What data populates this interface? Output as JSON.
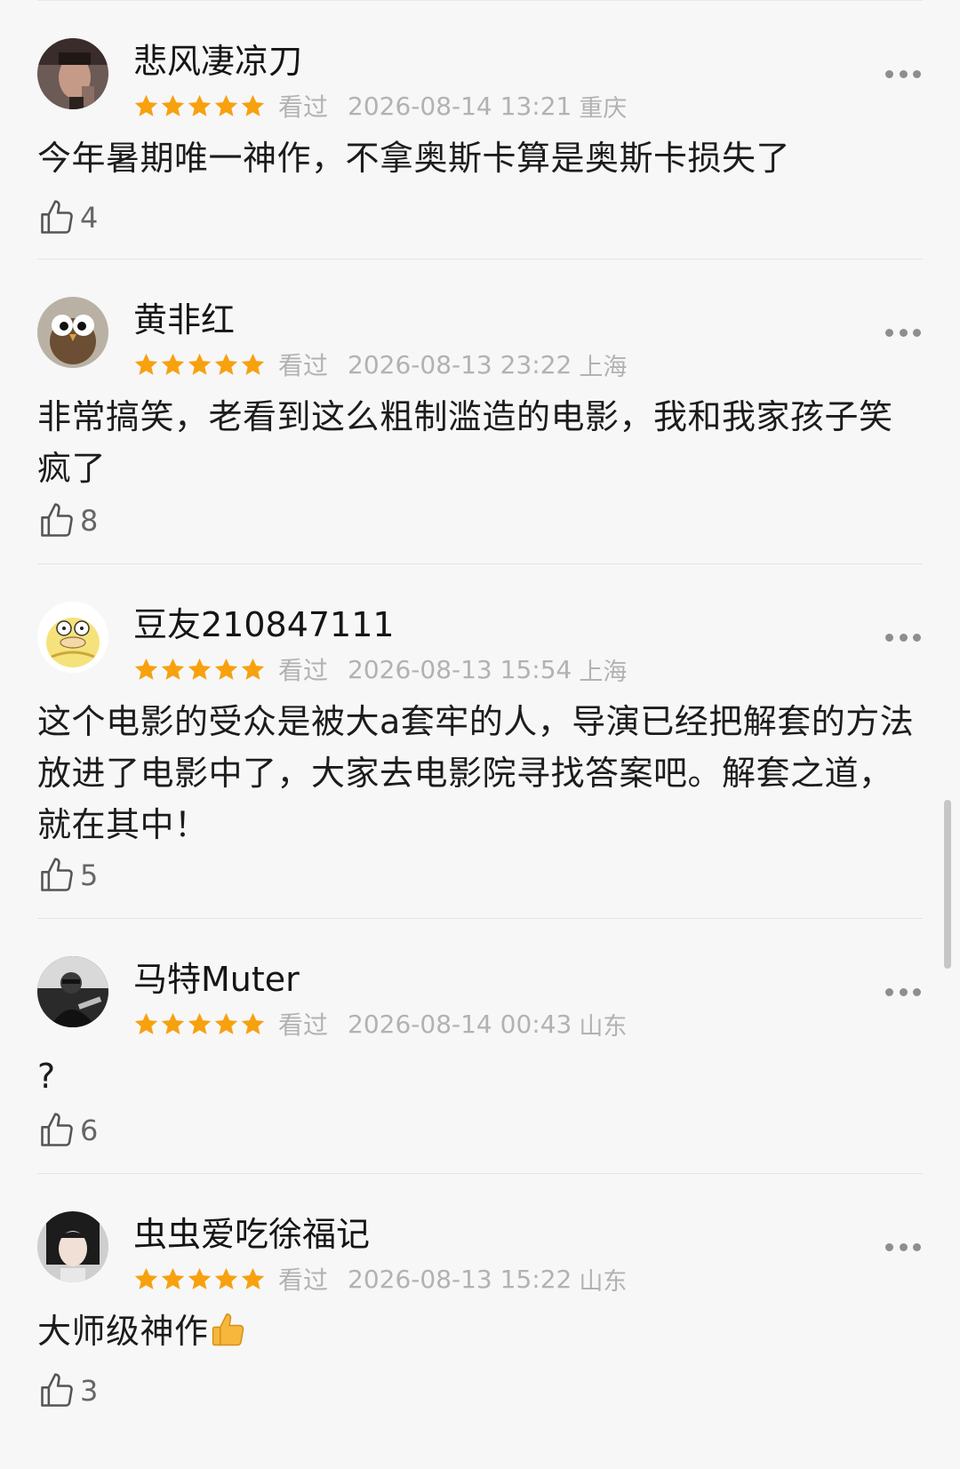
{
  "reviews": [
    {
      "username": "悲风凄凉刀",
      "rating": 5,
      "watched_label": "看过",
      "date": "2026-08-14 13:21",
      "location": "重庆",
      "content": "今年暑期唯一神作，不拿奥斯卡算是奥斯卡损失了",
      "likes": "4"
    },
    {
      "username": "黄非红",
      "rating": 5,
      "watched_label": "看过",
      "date": "2026-08-13 23:22",
      "location": "上海",
      "content": "非常搞笑，老看到这么粗制滥造的电影，我和我家孩子笑疯了",
      "likes": "8"
    },
    {
      "username": "豆友210847111",
      "rating": 5,
      "watched_label": "看过",
      "date": "2026-08-13 15:54",
      "location": "上海",
      "content": "这个电影的受众是被大a套牢的人，导演已经把解套的方法放进了电影中了，大家去电影院寻找答案吧。解套之道，就在其中！",
      "likes": "5"
    },
    {
      "username": "马特Muter",
      "rating": 5,
      "watched_label": "看过",
      "date": "2026-08-14 00:43",
      "location": "山东",
      "content": "?",
      "likes": "6"
    },
    {
      "username": "虫虫爱吃徐福记",
      "rating": 5,
      "watched_label": "看过",
      "date": "2026-08-13 15:22",
      "location": "山东",
      "content": "大师级神作",
      "likes": "3"
    }
  ],
  "colors": {
    "star": "#f7a10e",
    "meta_text": "#b2b2b2",
    "background": "#f7f7f7"
  },
  "icons": {
    "more": "more-dots-icon",
    "like": "thumbs-up-outline-icon",
    "emoji": "thumbs-up-emoji-icon"
  }
}
